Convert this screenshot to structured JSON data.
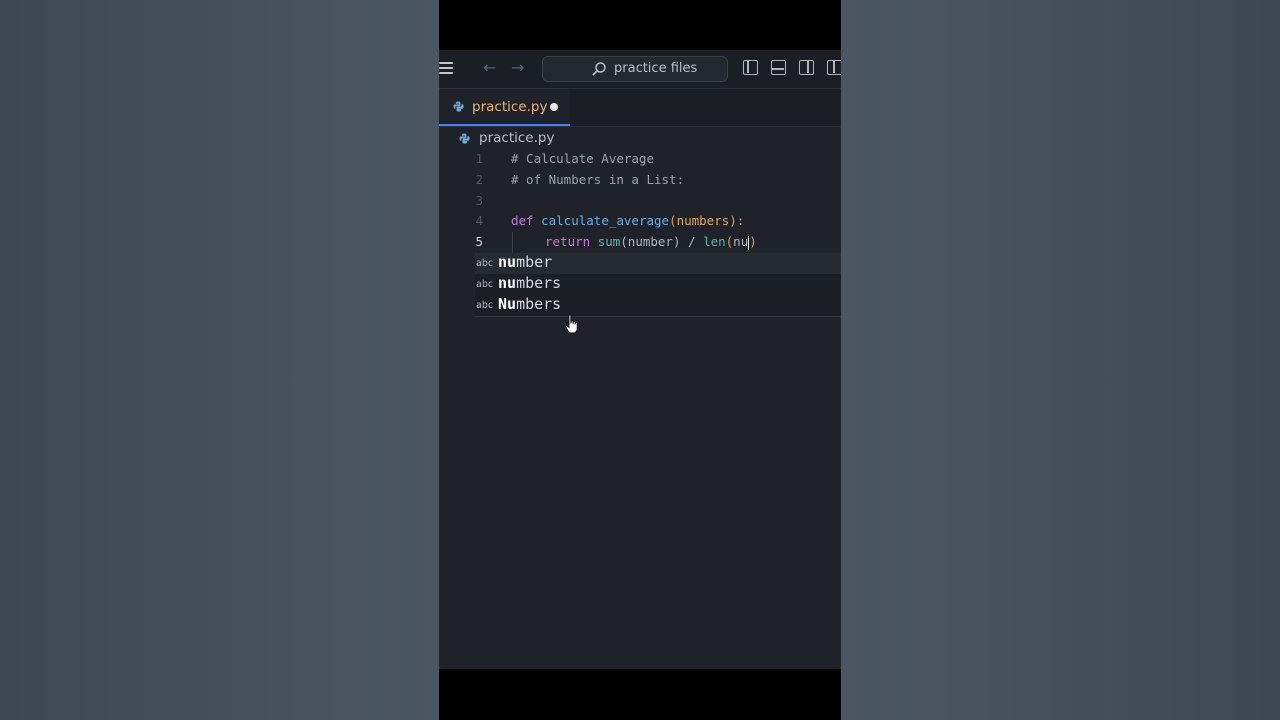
{
  "titlebar": {
    "search_placeholder": "practice files"
  },
  "tab": {
    "label": "practice.py",
    "unsaved": true
  },
  "breadcrumb": {
    "file": "practice.py"
  },
  "code": {
    "lines": [
      {
        "number": "1",
        "text": "# Calculate Average"
      },
      {
        "number": "2",
        "text": "# of Numbers in a List:"
      },
      {
        "number": "3",
        "text": ""
      },
      {
        "number": "4",
        "def": "def",
        "fn": "calculate_average",
        "open": "(",
        "param": "numbers",
        "close": "):"
      },
      {
        "number": "5",
        "ret": "return",
        "sum": "sum",
        "arg1": "(number)",
        "op": " / ",
        "len": "len",
        "open": "(",
        "typed": "nu",
        "close": ")"
      }
    ]
  },
  "suggestions": [
    {
      "kind": "abc",
      "match": "nu",
      "rest": "mber"
    },
    {
      "kind": "abc",
      "match": "nu",
      "rest": "mbers"
    },
    {
      "kind": "abc",
      "match": "Nu",
      "rest": "mbers"
    }
  ],
  "colors": {
    "accent": "#3b82f6",
    "tab_label": "#e6b673",
    "keyword": "#c678dd",
    "function": "#61afef",
    "parameter": "#e5a55a"
  }
}
